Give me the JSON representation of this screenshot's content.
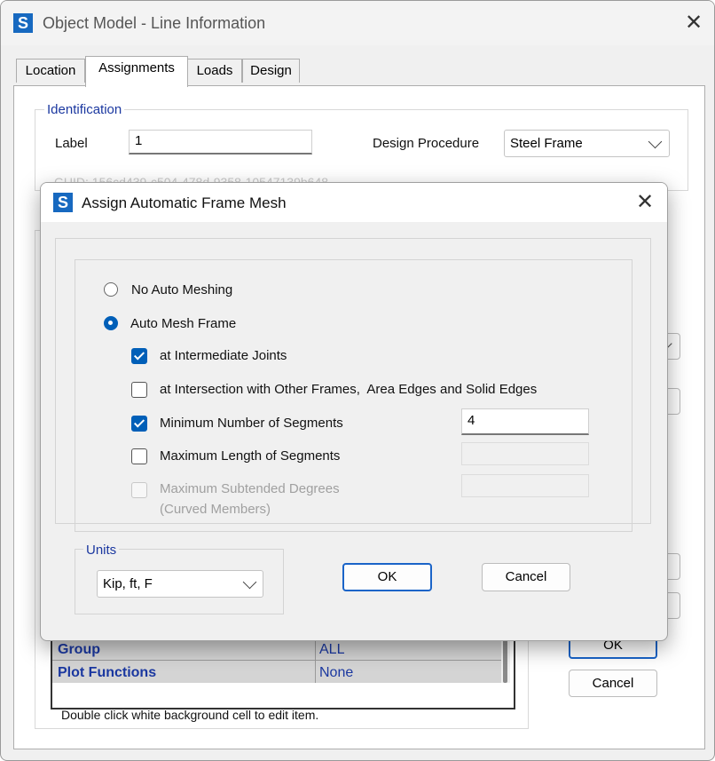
{
  "window": {
    "title": "Object Model - Line Information",
    "app_icon": "S"
  },
  "tabs": [
    "Location",
    "Assignments",
    "Loads",
    "Design"
  ],
  "identification": {
    "legend": "Identification",
    "label_caption": "Label",
    "label_value": "1",
    "design_procedure_caption": "Design Procedure",
    "design_procedure_value": "Steel Frame",
    "guid_text": "GUID: 156cd439-c504-478d-9358-10547139b648"
  },
  "assignments_grid": {
    "rows": [
      {
        "name": "Group",
        "value": "ALL"
      },
      {
        "name": "Plot Functions",
        "value": "None"
      }
    ],
    "hint": "Double click white background cell to edit item."
  },
  "main_buttons": {
    "ok": "OK",
    "cancel": "Cancel"
  },
  "dialog": {
    "title": "Assign Automatic Frame Mesh",
    "app_icon": "S",
    "options": {
      "no_auto_meshing": "No Auto Meshing",
      "auto_mesh_frame": "Auto Mesh Frame",
      "selected": "auto_mesh_frame"
    },
    "checks": {
      "intermediate_joints": {
        "label": "at Intermediate Joints",
        "checked": true
      },
      "intersection": {
        "label": "at Intersection with Other Frames,  Area Edges and Solid Edges",
        "checked": false
      },
      "min_segments": {
        "label": "Minimum Number of Segments",
        "checked": true,
        "value": "4"
      },
      "max_length": {
        "label": "Maximum Length of Segments",
        "checked": false,
        "value": ""
      },
      "max_subtended": {
        "label": "Maximum Subtended Degrees",
        "label2": "(Curved Members)",
        "checked": false,
        "value": ""
      }
    },
    "units": {
      "legend": "Units",
      "value": "Kip, ft, F"
    },
    "ok_label": "OK",
    "cancel_label": "Cancel"
  },
  "colors": {
    "accent": "#005fb8",
    "group_text": "#1b38a0",
    "icon_bg": "#1769c0"
  }
}
